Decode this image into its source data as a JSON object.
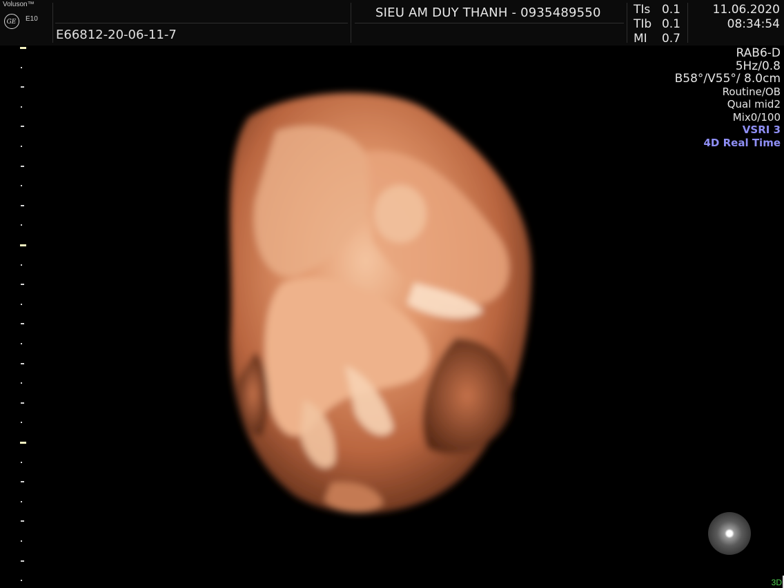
{
  "header": {
    "brand": "Voluson™",
    "model": "E10",
    "logo_text": "GE",
    "patient_id": "E66812-20-06-11-7",
    "clinic": "SIEU AM DUY THANH - 0935489550",
    "safety": [
      {
        "label": "TIs",
        "value": "0.1"
      },
      {
        "label": "TIb",
        "value": "0.1"
      },
      {
        "label": "MI",
        "value": "0.7"
      }
    ],
    "date": "11.06.2020",
    "time": "08:34:54"
  },
  "params": {
    "probe": "RAB6-D",
    "frequency": "5Hz/0.8",
    "angles": "B58°/V55°/ 8.0cm",
    "preset": "Routine/OB",
    "quality": "Qual mid2",
    "mix": "Mix0/100",
    "vsri": "VSRI 3",
    "mode": "4D Real Time"
  },
  "footer": {
    "mode_label": "3D"
  },
  "colors": {
    "background": "#000000",
    "tissue": "#d9825a",
    "highlight_param": "#8f8ff5",
    "mode_green": "#4fd04f"
  },
  "icons": [
    "ge-logo-icon",
    "orientation-ball-icon"
  ]
}
